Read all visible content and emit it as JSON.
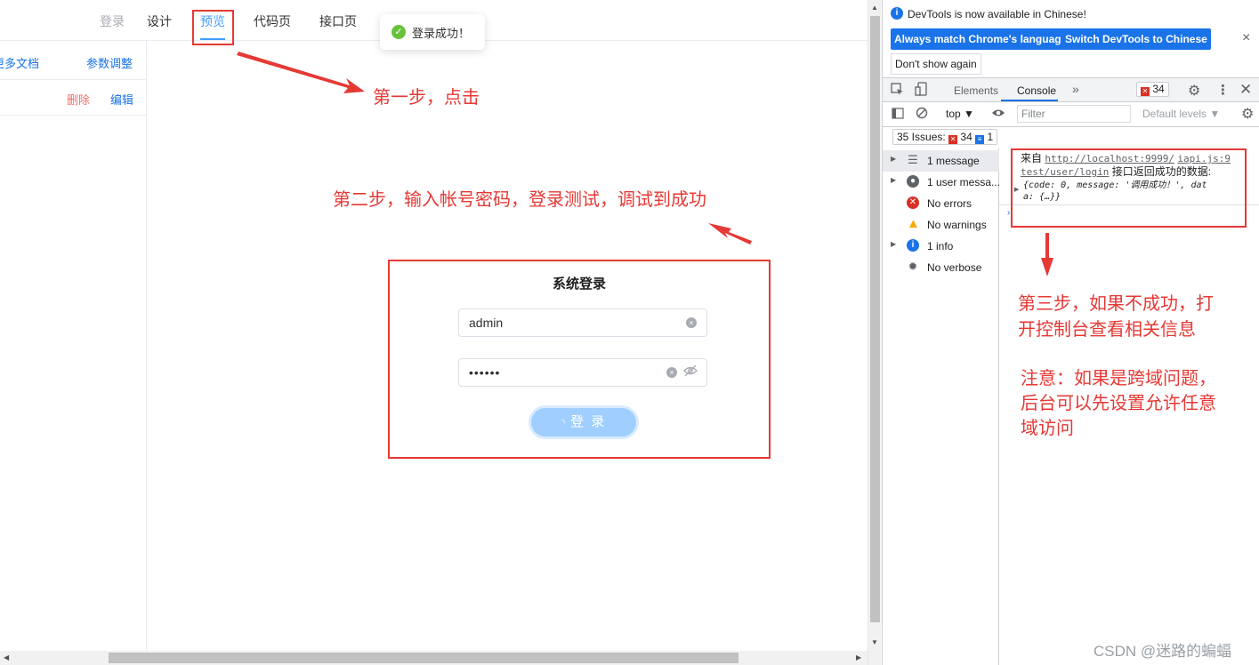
{
  "nav": {
    "tabs": [
      {
        "label": "登录",
        "state": "muted"
      },
      {
        "label": "设计",
        "state": "normal"
      },
      {
        "label": "预览",
        "state": "active"
      },
      {
        "label": "代码页",
        "state": "normal"
      },
      {
        "label": "接口页",
        "state": "normal"
      }
    ]
  },
  "sidebar": {
    "row1": {
      "left_link": "更多文档",
      "right_link": "参数调整"
    },
    "row2": {
      "delete": "删除",
      "edit": "编辑"
    }
  },
  "toast": {
    "icon": "success-check-icon",
    "message": "登录成功！"
  },
  "login": {
    "title": "系统登录",
    "username_value": "admin",
    "password_value": "••••••",
    "button_label": "登 录",
    "button_state": "loading"
  },
  "devtools": {
    "notice": "DevTools is now available in Chinese!",
    "btn_match": "Always match Chrome's language",
    "btn_switch": "Switch DevTools to Chinese",
    "btn_dont_show": "Don't show again",
    "tabs": {
      "elements": "Elements",
      "console": "Console"
    },
    "error_count": "34",
    "context": "top",
    "filter_placeholder": "Filter",
    "levels": "Default levels",
    "issues": {
      "label": "35 Issues:",
      "errors": "34",
      "info": "1"
    },
    "sidebar_items": [
      {
        "label": "1 message",
        "icon": "list-icon",
        "expandable": true
      },
      {
        "label": "1 user messa...",
        "icon": "user-icon",
        "expandable": true
      },
      {
        "label": "No errors",
        "icon": "error-icon",
        "expandable": false
      },
      {
        "label": "No warnings",
        "icon": "warning-icon",
        "expandable": false
      },
      {
        "label": "1 info",
        "icon": "info-icon",
        "expandable": true
      },
      {
        "label": "No verbose",
        "icon": "bug-icon",
        "expandable": false
      }
    ],
    "console_message": {
      "prefix": "来自",
      "url": "http://localhost:9999/",
      "source": "iapi.js:9",
      "path": "test/user/login",
      "suffix": "接口返回成功的数据:",
      "object_line1": "{code: 0, message: '调用成功！', dat",
      "object_line2": "a: {…}}"
    }
  },
  "annotations": {
    "step1": "第一步，点击",
    "step2": "第二步，输入帐号密码，登录测试，调试到成功",
    "step3_line1": "第三步，如果不成功，打",
    "step3_line2": "开控制台查看相关信息",
    "note_line1": "注意：如果是跨域问题，",
    "note_line2": "后台可以先设置允许任意",
    "note_line3": "域访问"
  },
  "watermark": "CSDN @迷路的蝙蝠",
  "colors": {
    "accent": "#409eff",
    "annotation": "#e53935",
    "devtools_blue": "#1a73e8",
    "success": "#67c23a"
  }
}
